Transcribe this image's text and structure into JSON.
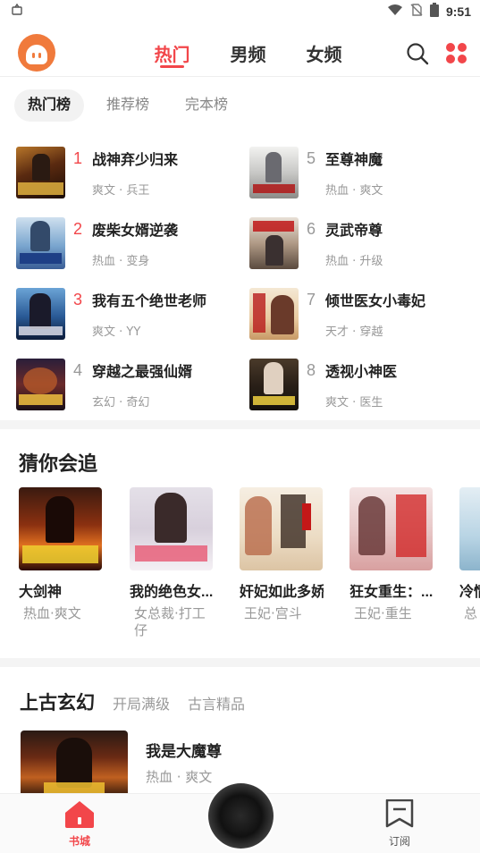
{
  "status_bar": {
    "time": "9:51"
  },
  "top_nav": {
    "tabs": [
      {
        "label": "热门",
        "active": true
      },
      {
        "label": "男频",
        "active": false
      },
      {
        "label": "女频",
        "active": false
      }
    ]
  },
  "rank_tabs": [
    {
      "label": "热门榜",
      "active": true
    },
    {
      "label": "推荐榜",
      "active": false
    },
    {
      "label": "完本榜",
      "active": false
    }
  ],
  "rank_list": [
    {
      "num": "1",
      "title": "战神弃少归来",
      "tags": "爽文 · 兵王"
    },
    {
      "num": "2",
      "title": "废柴女婿逆袭",
      "tags": "热血 · 变身"
    },
    {
      "num": "3",
      "title": "我有五个绝世老师",
      "tags": "爽文 · YY"
    },
    {
      "num": "4",
      "title": "穿越之最强仙婿",
      "tags": "玄幻 · 奇幻"
    },
    {
      "num": "5",
      "title": "至尊神魔",
      "tags": "热血 · 爽文"
    },
    {
      "num": "6",
      "title": "灵武帝尊",
      "tags": "热血 · 升级"
    },
    {
      "num": "7",
      "title": "倾世医女小毒妃",
      "tags": "天才 · 穿越"
    },
    {
      "num": "8",
      "title": "透视小神医",
      "tags": "爽文 · 医生"
    }
  ],
  "guess_section": {
    "title": "猜你会追",
    "books": [
      {
        "title": "大剑神",
        "tags": "热血·爽文"
      },
      {
        "title": "我的绝色女...",
        "tags": "女总裁·打工仔"
      },
      {
        "title": "奸妃如此多娇",
        "tags": "王妃·宫斗"
      },
      {
        "title": "狂女重生：...",
        "tags": "王妃·重生"
      },
      {
        "title": "冷情",
        "tags": "总"
      }
    ]
  },
  "category_section": {
    "tabs": [
      {
        "label": "上古玄幻",
        "active": true
      },
      {
        "label": "开局满级",
        "active": false
      },
      {
        "label": "古言精品",
        "active": false
      }
    ],
    "featured": {
      "title": "我是大魔尊",
      "tags": "热血 · 爽文"
    }
  },
  "tab_bar": {
    "home_label": "书城",
    "subscribe_label": "订阅"
  },
  "colors": {
    "accent": "#f2464a",
    "logo": "#f07a3c"
  }
}
